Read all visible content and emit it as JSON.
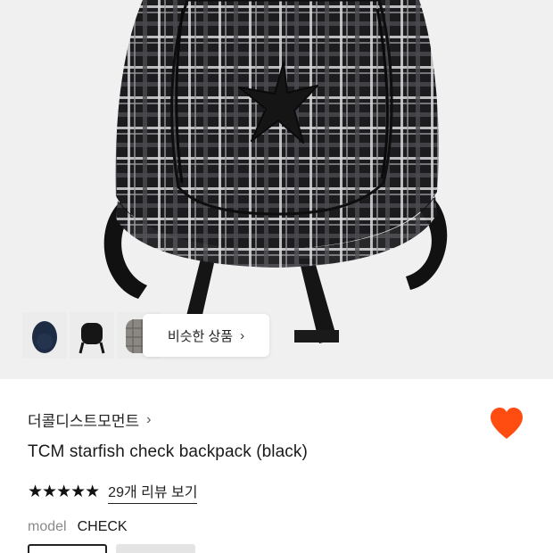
{
  "gallery": {
    "similar_button_label": "비슷한 상품",
    "thumbnails": [
      {
        "name": "navy-oval-backpack"
      },
      {
        "name": "black-mini-backpack"
      },
      {
        "name": "gray-check-backpack"
      }
    ]
  },
  "product": {
    "brand": "더콜디스트모먼트",
    "title": "TCM starfish check backpack (black)",
    "rating": {
      "stars_filled": 5,
      "stars_total": 5,
      "stars_glyphs": "★★★★★",
      "review_link": "29개 리뷰 보기"
    },
    "option": {
      "label": "model",
      "value": "CHECK"
    },
    "wishlist_color": "#ff4c11"
  },
  "icons": {
    "brand_chevron": "chevron-right-icon",
    "similar_chevron": "chevron-right-icon",
    "wishlist": "heart-icon"
  }
}
